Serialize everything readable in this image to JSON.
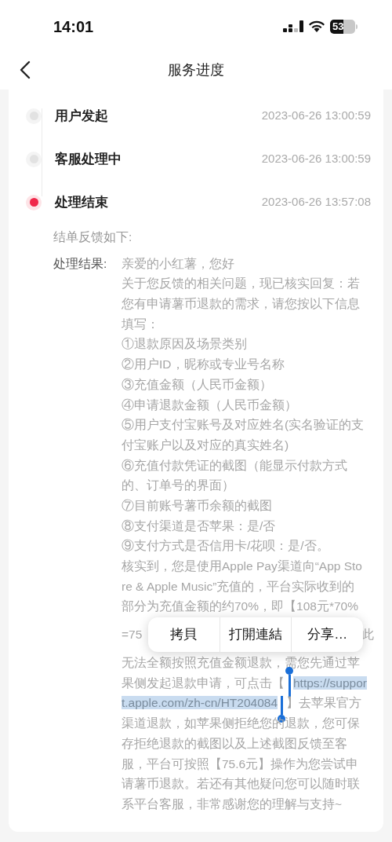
{
  "status_bar": {
    "time": "14:01",
    "battery": "53"
  },
  "nav": {
    "title": "服务进度"
  },
  "steps": [
    {
      "title": "用户发起",
      "time": "2023-06-26 13:00:59",
      "active": false
    },
    {
      "title": "客服处理中",
      "time": "2023-06-26 13:00:59",
      "active": false
    },
    {
      "title": "处理结束",
      "time": "2023-06-26 13:57:08",
      "active": true
    }
  ],
  "feedback_heading": "结单反馈如下:",
  "result_label": "处理结果:",
  "result_lines": [
    {
      "parts": [
        {
          "text": "亲爱的小红薯，您好",
          "selected": false
        }
      ]
    },
    {
      "parts": [
        {
          "text": "关于您反馈的相关问题，现已核实回复：若",
          "selected": false
        }
      ]
    },
    {
      "parts": [
        {
          "text": "您有申请薯币退款的需求，请您按以下信息",
          "selected": false
        }
      ]
    },
    {
      "parts": [
        {
          "text": "填写：",
          "selected": false
        }
      ]
    },
    {
      "parts": [
        {
          "text": "①退款原因及场景类别",
          "selected": false
        }
      ]
    },
    {
      "parts": [
        {
          "text": "②用户ID，昵称或专业号名称",
          "selected": false
        }
      ]
    },
    {
      "parts": [
        {
          "text": "③充值金额（人民币金额）",
          "selected": false
        }
      ]
    },
    {
      "parts": [
        {
          "text": "④申请退款金额（人民币金额）",
          "selected": false
        }
      ]
    },
    {
      "parts": [
        {
          "text": "⑤用户支付宝账号及对应姓名(实名验证的支",
          "selected": false
        }
      ]
    },
    {
      "parts": [
        {
          "text": "付宝账户以及对应的真实姓名)",
          "selected": false
        }
      ]
    },
    {
      "parts": [
        {
          "text": "⑥充值付款凭证的截图（能显示付款方式",
          "selected": false
        }
      ]
    },
    {
      "parts": [
        {
          "text": "的、订单号的界面）",
          "selected": false
        }
      ]
    },
    {
      "parts": [
        {
          "text": "⑦目前账号薯币余额的截图",
          "selected": false
        }
      ]
    },
    {
      "parts": [
        {
          "text": "⑧支付渠道是否苹果：是/否",
          "selected": false
        }
      ]
    },
    {
      "parts": [
        {
          "text": "⑨支付方式是否信用卡/花呗：是/否。",
          "selected": false
        }
      ]
    },
    {
      "parts": [
        {
          "text": "核实到，您是使用Apple Pay渠道向“App Sto",
          "selected": false
        }
      ]
    },
    {
      "parts": [
        {
          "text": "re & Apple Music”充值的，平台实际收到的",
          "selected": false
        }
      ]
    },
    {
      "parts": [
        {
          "text": "部分为充值金额的约70%，即【108元*70%",
          "selected": false
        }
      ]
    },
    {
      "kind": "split",
      "parts": [
        {
          "text": "=75",
          "selected": false
        },
        {
          "text": "此",
          "selected": false
        }
      ]
    },
    {
      "parts": [
        {
          "text": "无法全额按照充值金额退款，需您先通过苹",
          "selected": false
        }
      ]
    },
    {
      "parts": [
        {
          "text": "果侧发起退款申请，可点击【",
          "selected": false
        },
        {
          "text": "https://suppor",
          "selected": true
        }
      ]
    },
    {
      "parts": [
        {
          "text": "t.apple.com/zh-cn/HT204084",
          "selected": true
        },
        {
          "text": "】去苹果官方",
          "selected": false
        }
      ]
    },
    {
      "parts": [
        {
          "text": "渠道退款，如苹果侧拒绝您的退款，您可保",
          "selected": false
        }
      ]
    },
    {
      "parts": [
        {
          "text": "存拒绝退款的截图以及上述截图反馈至客",
          "selected": false
        }
      ]
    },
    {
      "parts": [
        {
          "text": "服，平台可按照【75.6元】操作为您尝试申",
          "selected": false
        }
      ]
    },
    {
      "parts": [
        {
          "text": "请薯币退款。若还有其他疑问您可以随时联",
          "selected": false
        }
      ]
    },
    {
      "parts": [
        {
          "text": "系平台客服，非常感谢您的理解与支持~",
          "selected": false
        }
      ]
    }
  ],
  "context_menu": [
    "拷貝",
    "打開連結",
    "分享…"
  ]
}
